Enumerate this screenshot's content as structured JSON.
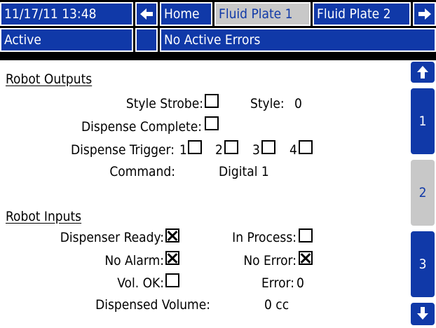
{
  "header": {
    "datetime": "11/17/11 13:48",
    "nav_left_icon": "left-arrow-icon",
    "tabs": [
      {
        "label": "Home"
      },
      {
        "label": "Fluid Plate 1"
      },
      {
        "label": "Fluid Plate 2"
      }
    ],
    "nav_right_icon": "right-arrow-icon"
  },
  "status": {
    "mode": "Active",
    "indicator": "",
    "errors": "No Active Errors"
  },
  "outputs": {
    "title": "Robot Outputs",
    "style_strobe_label": "Style Strobe:",
    "style_label": "Style:",
    "style_value": "0",
    "dispense_complete_label": "Dispense Complete:",
    "dispense_trigger_label": "Dispense Trigger:",
    "triggers": [
      "1",
      "2",
      "3",
      "4"
    ],
    "command_label": "Command:",
    "command_value": "Digital 1"
  },
  "inputs": {
    "title": "Robot Inputs",
    "dispenser_ready_label": "Dispenser Ready:",
    "in_process_label": "In Process:",
    "no_alarm_label": "No Alarm:",
    "no_error_label": "No Error:",
    "vol_ok_label": "Vol. OK:",
    "error_label": "Error:",
    "error_value": "0",
    "dispensed_volume_label": "Dispensed Volume:",
    "dispensed_volume_value": "0 cc"
  },
  "side": {
    "up_icon": "up-arrow-icon",
    "pages": [
      "1",
      "2",
      "3"
    ],
    "selected_page": "2",
    "down_icon": "down-arrow-icon"
  },
  "colors": {
    "accent_blue": "#1039a8",
    "inactive_gray": "#c8c8c8"
  }
}
